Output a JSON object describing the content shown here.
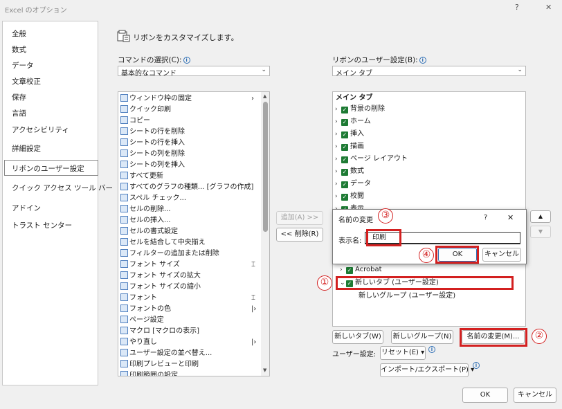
{
  "window": {
    "title": "Excel のオプション",
    "help": "?",
    "close": "✕"
  },
  "sidebar": {
    "items": [
      "全般",
      "数式",
      "データ",
      "文章校正",
      "保存",
      "言語",
      "アクセシビリティ",
      "詳細設定",
      "リボンのユーザー設定",
      "クイック アクセス ツール バー",
      "アドイン",
      "トラスト センター"
    ],
    "selected": "リボンのユーザー設定"
  },
  "header": {
    "title": "リボンをカスタマイズします。"
  },
  "commands": {
    "label": "コマンドの選択(C):",
    "dropdown_value": "基本的なコマンド",
    "items": [
      {
        "label": "ウィンドウ枠の固定",
        "suffix": "›"
      },
      {
        "label": "クイック印刷",
        "suffix": ""
      },
      {
        "label": "コピー",
        "suffix": ""
      },
      {
        "label": "シートの行を削除",
        "suffix": ""
      },
      {
        "label": "シートの行を挿入",
        "suffix": ""
      },
      {
        "label": "シートの列を削除",
        "suffix": ""
      },
      {
        "label": "シートの列を挿入",
        "suffix": ""
      },
      {
        "label": "すべて更新",
        "suffix": ""
      },
      {
        "label": "すべてのグラフの種類... [グラフの作成]",
        "suffix": ""
      },
      {
        "label": "スペル チェック...",
        "suffix": ""
      },
      {
        "label": "セルの削除...",
        "suffix": ""
      },
      {
        "label": "セルの挿入...",
        "suffix": ""
      },
      {
        "label": "セルの書式設定",
        "suffix": ""
      },
      {
        "label": "セルを結合して中央揃え",
        "suffix": ""
      },
      {
        "label": "フィルターの追加または削除",
        "suffix": ""
      },
      {
        "label": "フォント サイズ",
        "suffix": "⌶"
      },
      {
        "label": "フォント サイズの拡大",
        "suffix": ""
      },
      {
        "label": "フォント サイズの縮小",
        "suffix": ""
      },
      {
        "label": "フォント",
        "suffix": "⌶"
      },
      {
        "label": "フォントの色",
        "suffix": "|›"
      },
      {
        "label": "ページ設定",
        "suffix": ""
      },
      {
        "label": "マクロ [マクロの表示]",
        "suffix": ""
      },
      {
        "label": "やり直し",
        "suffix": "|›"
      },
      {
        "label": "ユーザー設定の並べ替え...",
        "suffix": ""
      },
      {
        "label": "印刷プレビューと印刷",
        "suffix": ""
      },
      {
        "label": "印刷範囲の設定",
        "suffix": ""
      }
    ]
  },
  "middle": {
    "add": "追加(A) >>",
    "remove": "<< 削除(R)"
  },
  "ribbon": {
    "label": "リボンのユーザー設定(B):",
    "dropdown_value": "メイン タブ",
    "root": "メイン タブ",
    "tabs": [
      "背景の削除",
      "ホーム",
      "挿入",
      "描画",
      "ページ レイアウト",
      "数式",
      "データ",
      "校閲",
      "表示"
    ],
    "acrobat": "Acrobat",
    "new_tab": "新しいタブ (ユーザー設定)",
    "new_group": "新しいグループ (ユーザー設定)",
    "buttons": {
      "new_tab": "新しいタブ(W)",
      "new_group": "新しいグループ(N)",
      "rename": "名前の変更(M)..."
    },
    "user_setting_label": "ユーザー設定:",
    "reset": "リセット(E) ▾",
    "import_export": "インポート/エクスポート(P) ▾"
  },
  "rename_dialog": {
    "title": "名前の変更",
    "help": "?",
    "close": "✕",
    "field_label": "表示名:",
    "field_value": "印刷",
    "ok": "OK",
    "cancel": "キャンセル"
  },
  "callouts": [
    "①",
    "②",
    "③",
    "④"
  ],
  "footer": {
    "ok": "OK",
    "cancel": "キャンセル"
  },
  "colors": {
    "checkbox": "#1e7b34",
    "highlight": "#d32020",
    "info": "#2f6fb5"
  }
}
